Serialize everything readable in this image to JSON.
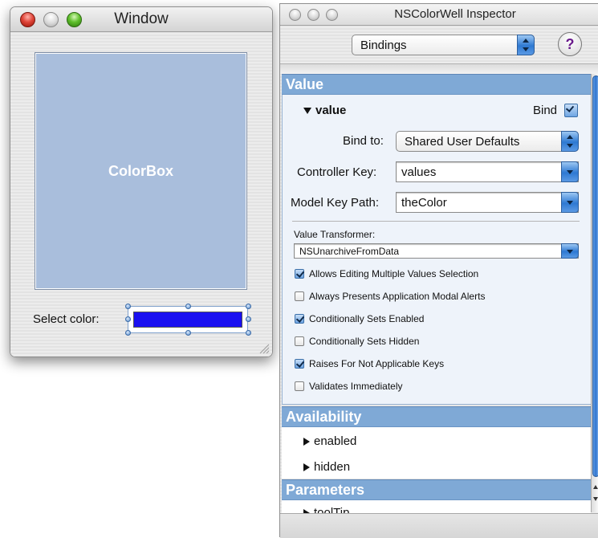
{
  "window": {
    "title": "Window",
    "colorbox_label": "ColorBox",
    "select_color_label": "Select color:",
    "well_color": "#1a10f0"
  },
  "inspector": {
    "title": "NSColorWell Inspector",
    "mode_popup": "Bindings",
    "help_label": "?",
    "value_section": {
      "header": "Value",
      "disclosure": "value",
      "bind_label": "Bind",
      "bind_checked": true,
      "bind_to_label": "Bind to:",
      "bind_to_value": "Shared User Defaults",
      "controller_key_label": "Controller Key:",
      "controller_key_value": "values",
      "model_key_path_label": "Model Key Path:",
      "model_key_path_value": "theColor",
      "value_transformer_label": "Value Transformer:",
      "value_transformer_value": "NSUnarchiveFromData",
      "options": [
        {
          "label": "Allows Editing Multiple Values Selection",
          "checked": true
        },
        {
          "label": "Always Presents Application Modal Alerts",
          "checked": false
        },
        {
          "label": "Conditionally Sets Enabled",
          "checked": true
        },
        {
          "label": "Conditionally Sets Hidden",
          "checked": false
        },
        {
          "label": "Raises For Not Applicable Keys",
          "checked": true
        },
        {
          "label": "Validates Immediately",
          "checked": false
        }
      ]
    },
    "availability_section": {
      "header": "Availability",
      "items": [
        "enabled",
        "hidden"
      ]
    },
    "parameters_section": {
      "header": "Parameters",
      "items": [
        "toolTip"
      ]
    }
  },
  "colors": {
    "section_header": "#7fa9d6",
    "colorbox_fill": "#a9bedc",
    "aqua_blue": "#2e79d2"
  }
}
